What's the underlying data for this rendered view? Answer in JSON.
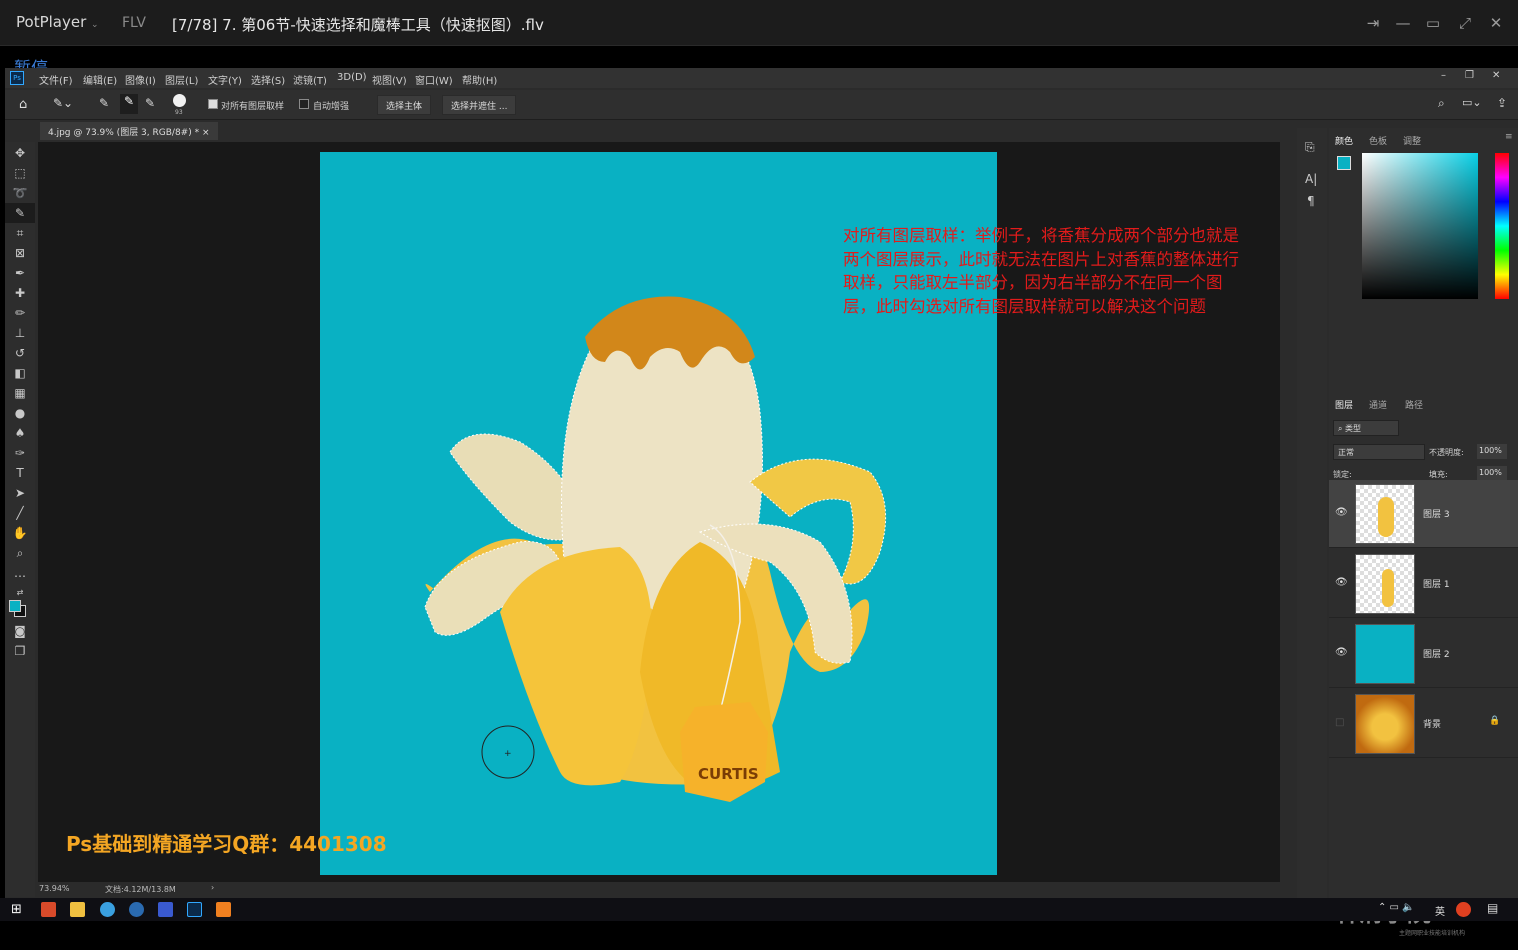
{
  "player": {
    "name": "PotPlayer",
    "format": "FLV",
    "title": "[7/78] 7. 第06节-快速选择和魔棒工具（快速抠图）.flv",
    "status": "暂停"
  },
  "ps": {
    "logo": "Ps",
    "menu": [
      "文件(F)",
      "编辑(E)",
      "图像(I)",
      "图层(L)",
      "文字(Y)",
      "选择(S)",
      "滤镜(T)",
      "3D(D)",
      "视图(V)",
      "窗口(W)",
      "帮助(H)"
    ],
    "options": {
      "brush_size": "93",
      "sample_all_layers": "对所有图层取样",
      "auto_enhance": "自动增强",
      "select_subject": "选择主体",
      "select_and_mask": "选择并遮住 ..."
    },
    "doc_tab": "4.jpg @ 73.9% (图层 3, RGB/8#) *",
    "status": {
      "zoom": "73.94%",
      "doc": "文档:4.12M/13.8M"
    },
    "annotation": "对所有图层取样：举例子，将香蕉分成两个部分也就是两个图层展示，此时就无法在图片上对香蕉的整体进行取样，只能取左半部分，因为右半部分不在同一个图层，此时勾选对所有图层取样就可以解决这个问题",
    "watermark_qq": "Ps基础到精通学习Q群：4401308",
    "tag_text": "CURTIS",
    "colors": {
      "canvas": "#09b1c3",
      "annotation": "#e21b1b",
      "qq": "#f4a623"
    }
  },
  "panels": {
    "color_tabs": [
      "颜色",
      "色板",
      "调整"
    ],
    "layer_tabs": [
      "图层",
      "通道",
      "路径"
    ],
    "kind": "类型",
    "blend": "正常",
    "opacity_label": "不透明度:",
    "opacity": "100%",
    "lock_label": "锁定:",
    "fill_label": "填充:",
    "fill": "100%",
    "layers": [
      {
        "name": "图层 3",
        "visible": true,
        "selected": true
      },
      {
        "name": "图层 1",
        "visible": true,
        "selected": false
      },
      {
        "name": "图层 2",
        "visible": true,
        "selected": false
      },
      {
        "name": "背景",
        "visible": false,
        "selected": false
      }
    ],
    "brand": "林清学院",
    "brand_sub": "主题网职业技能培训机构"
  },
  "taskbar": {
    "ime": "英"
  }
}
